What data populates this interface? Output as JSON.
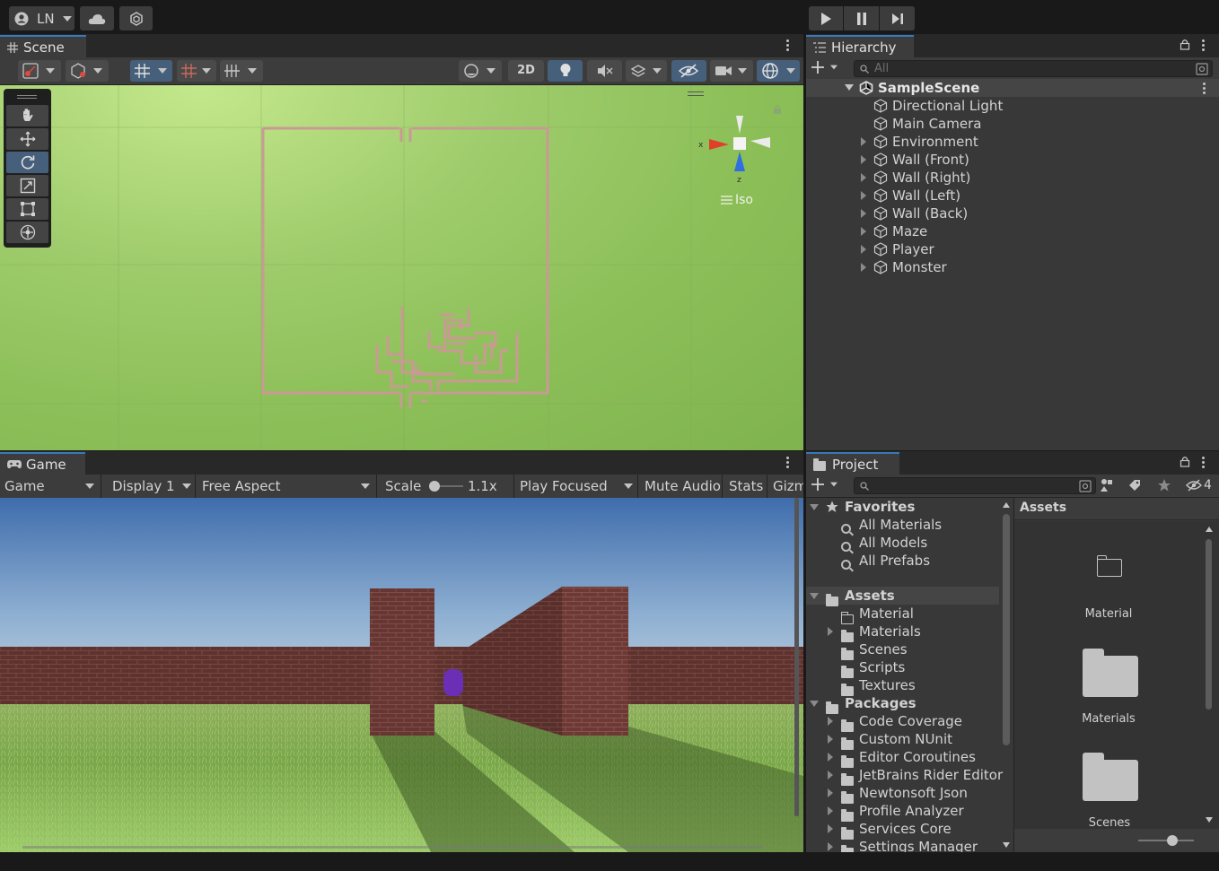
{
  "top_toolbar": {
    "account_label": "LN",
    "play_icon": "play-icon",
    "pause_icon": "pause-icon",
    "step_icon": "step-icon"
  },
  "scene_panel": {
    "tab_label": "Scene",
    "two_d_label": "2D",
    "orientation_label": "Iso",
    "gizmo_axes": [
      "x",
      "z"
    ]
  },
  "hierarchy_panel": {
    "tab_label": "Hierarchy",
    "search_placeholder": "All",
    "scene_name": "SampleScene",
    "items": [
      {
        "label": "Directional Light",
        "expandable": false
      },
      {
        "label": "Main Camera",
        "expandable": false
      },
      {
        "label": "Environment",
        "expandable": true
      },
      {
        "label": "Wall (Front)",
        "expandable": true
      },
      {
        "label": "Wall (Right)",
        "expandable": true
      },
      {
        "label": "Wall (Left)",
        "expandable": true
      },
      {
        "label": "Wall (Back)",
        "expandable": true
      },
      {
        "label": "Maze",
        "expandable": true
      },
      {
        "label": "Player",
        "expandable": true
      },
      {
        "label": "Monster",
        "expandable": true
      }
    ]
  },
  "game_panel": {
    "tab_label": "Game",
    "view_dropdown": "Game",
    "display_dropdown": "Display 1",
    "aspect_dropdown": "Free Aspect",
    "scale_label": "Scale",
    "scale_value": "1.1x",
    "play_mode_dropdown": "Play Focused",
    "mute_label": "Mute Audio",
    "stats_label": "Stats",
    "gizmos_label": "Gizm"
  },
  "project_panel": {
    "tab_label": "Project",
    "hidden_count": "4",
    "favorites_label": "Favorites",
    "favorites": [
      "All Materials",
      "All Models",
      "All Prefabs"
    ],
    "assets_label": "Assets",
    "assets": [
      {
        "label": "Material",
        "expandable": false,
        "empty": true
      },
      {
        "label": "Materials",
        "expandable": true,
        "empty": false
      },
      {
        "label": "Scenes",
        "expandable": false,
        "empty": false
      },
      {
        "label": "Scripts",
        "expandable": false,
        "empty": false
      },
      {
        "label": "Textures",
        "expandable": false,
        "empty": false
      }
    ],
    "packages_label": "Packages",
    "packages": [
      "Code Coverage",
      "Custom NUnit",
      "Editor Coroutines",
      "JetBrains Rider Editor",
      "Newtonsoft Json",
      "Profile Analyzer",
      "Services Core",
      "Settings Manager"
    ],
    "breadcrumb": "Assets",
    "grid_items": [
      "Material",
      "Materials",
      "Scenes"
    ]
  },
  "colors": {
    "accent": "#3a79bb",
    "panel_bg": "#383838",
    "toolbar_bg": "#3c3c3c",
    "scene_ground": "#8cbf58",
    "maze_wall": "#c99a94",
    "brick": "#7a3f3a",
    "monster": "#6a2fb5"
  }
}
